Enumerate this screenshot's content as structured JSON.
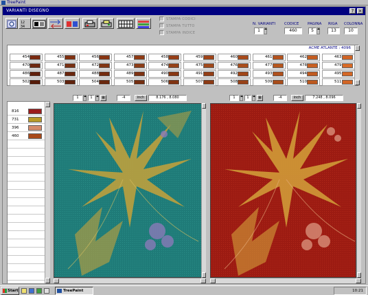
{
  "app": {
    "title": "TreePaint"
  },
  "window": {
    "title": "VARIANTI DISEGNO"
  },
  "options": {
    "stampa_codici": "STAMPA CODICI",
    "stampa_tutto": "STAMPA TUTTO",
    "stampa_indice": "STAMPA INDICE"
  },
  "fields": {
    "n_varianti": {
      "label": "N. VARIANTI",
      "value": "1"
    },
    "codice": {
      "label": "CODICE",
      "value": "460"
    },
    "pagina": {
      "label": "PAGINA",
      "value": "5"
    },
    "riga": {
      "label": "RIGA",
      "value": "13"
    },
    "colonna": {
      "label": "COLONNA",
      "value": "10"
    }
  },
  "palette": {
    "title": "ACME ATLANTE : 4096",
    "rows": [
      [
        {
          "code": "454",
          "color": "#7a2a10"
        },
        {
          "code": "455",
          "color": "#803010"
        },
        {
          "code": "456",
          "color": "#873412"
        },
        {
          "code": "457",
          "color": "#8f3a14"
        },
        {
          "code": "458",
          "color": "#963e16"
        },
        {
          "code": "459",
          "color": "#a04418"
        },
        {
          "code": "460",
          "color": "#a84a1a"
        },
        {
          "code": "461",
          "color": "#b4521c"
        },
        {
          "code": "462",
          "color": "#c45c20"
        },
        {
          "code": "463",
          "color": "#d06424"
        }
      ],
      [
        {
          "code": "470",
          "color": "#6e2810"
        },
        {
          "code": "471",
          "color": "#783012"
        },
        {
          "code": "472",
          "color": "#823614"
        },
        {
          "code": "473",
          "color": "#8c3c16"
        },
        {
          "code": "474",
          "color": "#964218"
        },
        {
          "code": "475",
          "color": "#a0481a"
        },
        {
          "code": "476",
          "color": "#aa4e1c"
        },
        {
          "code": "477",
          "color": "#b6561e"
        },
        {
          "code": "478",
          "color": "#c86022"
        },
        {
          "code": "479",
          "color": "#d86a26"
        }
      ],
      [
        {
          "code": "486",
          "color": "#60200c"
        },
        {
          "code": "487",
          "color": "#6a260e"
        },
        {
          "code": "488",
          "color": "#742c10"
        },
        {
          "code": "489",
          "color": "#7e3212"
        },
        {
          "code": "490",
          "color": "#883814"
        },
        {
          "code": "491",
          "color": "#943e16"
        },
        {
          "code": "492",
          "color": "#a04618"
        },
        {
          "code": "493",
          "color": "#b0501c"
        },
        {
          "code": "494",
          "color": "#c05a20"
        },
        {
          "code": "495",
          "color": "#d46826"
        }
      ],
      [
        {
          "code": "502",
          "color": "#561c0a"
        },
        {
          "code": "503",
          "color": "#60220c"
        },
        {
          "code": "504",
          "color": "#6a280e"
        },
        {
          "code": "505",
          "color": "#742e10"
        },
        {
          "code": "506",
          "color": "#803412"
        },
        {
          "code": "507",
          "color": "#8c3a14"
        },
        {
          "code": "508",
          "color": "#984218"
        },
        {
          "code": "509",
          "color": "#a84c1a"
        },
        {
          "code": "510",
          "color": "#bc581e"
        },
        {
          "code": "511",
          "color": "#d26626"
        }
      ]
    ]
  },
  "color_list": [
    {
      "code": "816",
      "color": "#9a1c1c"
    },
    {
      "code": "731",
      "color": "#b89a28"
    },
    {
      "code": "396",
      "color": "#d48a6a"
    },
    {
      "code": "460",
      "color": "#a84a1a"
    }
  ],
  "view_left": {
    "field1": "1",
    "field2": "1",
    "offset": "-4",
    "unit": "inch",
    "coords": "8.176 , 8.080",
    "bg": "#1e7a78"
  },
  "view_right": {
    "field1": "1",
    "field2": "1",
    "offset": "-4",
    "unit": "inch",
    "coords": "7.248 , 8.096",
    "bg": "#9a1a12"
  },
  "taskbar": {
    "start": "Start",
    "task": "TreePaint",
    "clock": "10:21"
  }
}
